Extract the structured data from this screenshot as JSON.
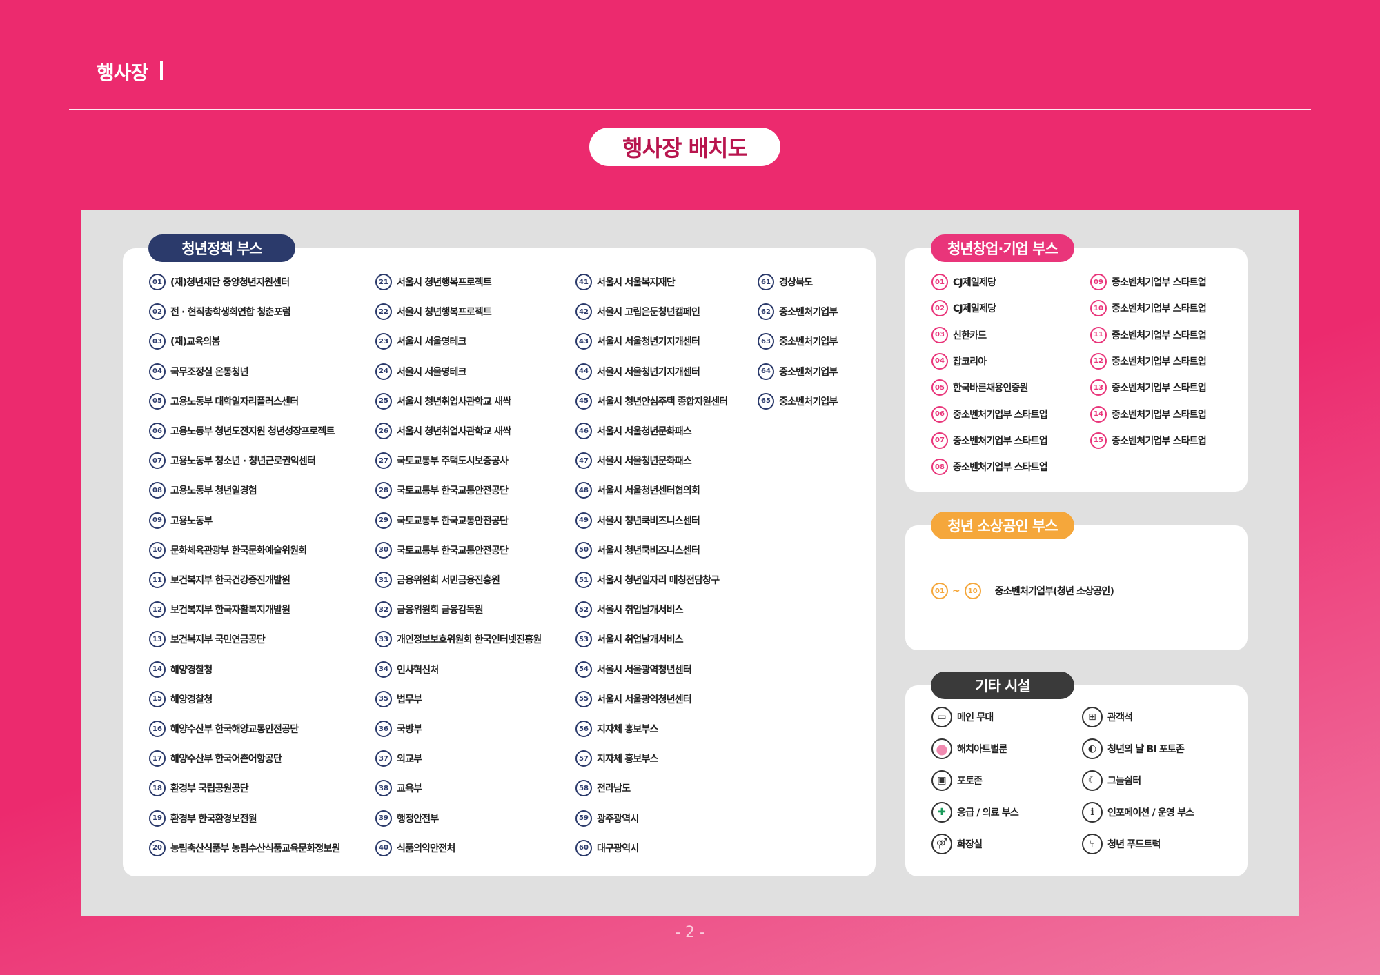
{
  "header": {
    "title": "행사장"
  },
  "main_title": "행사장 배치도",
  "policy": {
    "title": "청년정책 부스",
    "items": [
      {
        "n": "01",
        "t": "(재)청년재단 중앙청년지원센터"
      },
      {
        "n": "02",
        "t": "전 · 현직총학생회연합 청춘포럼"
      },
      {
        "n": "03",
        "t": "(재)교육의봄"
      },
      {
        "n": "04",
        "t": "국무조정실 온통청년"
      },
      {
        "n": "05",
        "t": "고용노동부 대학일자리플러스센터"
      },
      {
        "n": "06",
        "t": "고용노동부 청년도전지원 청년성장프로젝트"
      },
      {
        "n": "07",
        "t": "고용노동부 청소년 · 청년근로권익센터"
      },
      {
        "n": "08",
        "t": "고용노동부 청년일경험"
      },
      {
        "n": "09",
        "t": "고용노동부"
      },
      {
        "n": "10",
        "t": "문화체육관광부 한국문화예술위원회"
      },
      {
        "n": "11",
        "t": "보건복지부 한국건강증진개발원"
      },
      {
        "n": "12",
        "t": "보건복지부 한국자활복지개발원"
      },
      {
        "n": "13",
        "t": "보건복지부 국민연금공단"
      },
      {
        "n": "14",
        "t": "해양경찰청"
      },
      {
        "n": "15",
        "t": "해양경찰청"
      },
      {
        "n": "16",
        "t": "해양수산부 한국해양교통안전공단"
      },
      {
        "n": "17",
        "t": "해양수산부 한국어촌어항공단"
      },
      {
        "n": "18",
        "t": "환경부 국립공원공단"
      },
      {
        "n": "19",
        "t": "환경부 한국환경보전원"
      },
      {
        "n": "20",
        "t": "농림축산식품부 농림수산식품교육문화정보원"
      },
      {
        "n": "21",
        "t": "서울시 청년행복프로젝트"
      },
      {
        "n": "22",
        "t": "서울시 청년행복프로젝트"
      },
      {
        "n": "23",
        "t": "서울시 서울영테크"
      },
      {
        "n": "24",
        "t": "서울시 서울영테크"
      },
      {
        "n": "25",
        "t": "서울시 청년취업사관학교 새싹"
      },
      {
        "n": "26",
        "t": "서울시 청년취업사관학교 새싹"
      },
      {
        "n": "27",
        "t": "국토교통부 주택도시보증공사"
      },
      {
        "n": "28",
        "t": "국토교통부 한국교통안전공단"
      },
      {
        "n": "29",
        "t": "국토교통부 한국교통안전공단"
      },
      {
        "n": "30",
        "t": "국토교통부 한국교통안전공단"
      },
      {
        "n": "31",
        "t": "금융위원회 서민금융진흥원"
      },
      {
        "n": "32",
        "t": "금융위원회 금융감독원"
      },
      {
        "n": "33",
        "t": "개인정보보호위원회 한국인터넷진흥원"
      },
      {
        "n": "34",
        "t": "인사혁신처"
      },
      {
        "n": "35",
        "t": "법무부"
      },
      {
        "n": "36",
        "t": "국방부"
      },
      {
        "n": "37",
        "t": "외교부"
      },
      {
        "n": "38",
        "t": "교육부"
      },
      {
        "n": "39",
        "t": "행정안전부"
      },
      {
        "n": "40",
        "t": "식품의약안전처"
      },
      {
        "n": "41",
        "t": "서울시 서울복지재단"
      },
      {
        "n": "42",
        "t": "서울시 고립은둔청년캠페인"
      },
      {
        "n": "43",
        "t": "서울시 서울청년기지개센터"
      },
      {
        "n": "44",
        "t": "서울시 서울청년기지개센터"
      },
      {
        "n": "45",
        "t": "서울시 청년안심주택 종합지원센터"
      },
      {
        "n": "46",
        "t": "서울시 서울청년문화패스"
      },
      {
        "n": "47",
        "t": "서울시 서울청년문화패스"
      },
      {
        "n": "48",
        "t": "서울시 서울청년센터협의회"
      },
      {
        "n": "49",
        "t": "서울시 청년쿡비즈니스센터"
      },
      {
        "n": "50",
        "t": "서울시 청년쿡비즈니스센터"
      },
      {
        "n": "51",
        "t": "서울시 청년일자리 매칭전담창구"
      },
      {
        "n": "52",
        "t": "서울시 취업날개서비스"
      },
      {
        "n": "53",
        "t": "서울시 취업날개서비스"
      },
      {
        "n": "54",
        "t": "서울시 서울광역청년센터"
      },
      {
        "n": "55",
        "t": "서울시 서울광역청년센터"
      },
      {
        "n": "56",
        "t": "지자체 홍보부스"
      },
      {
        "n": "57",
        "t": "지자체 홍보부스"
      },
      {
        "n": "58",
        "t": "전라남도"
      },
      {
        "n": "59",
        "t": "광주광역시"
      },
      {
        "n": "60",
        "t": "대구광역시"
      },
      {
        "n": "61",
        "t": "경상북도"
      },
      {
        "n": "62",
        "t": "중소벤처기업부"
      },
      {
        "n": "63",
        "t": "중소벤처기업부"
      },
      {
        "n": "64",
        "t": "중소벤처기업부"
      },
      {
        "n": "65",
        "t": "중소벤처기업부"
      }
    ]
  },
  "startup": {
    "title": "청년창업·기업 부스",
    "items": [
      {
        "n": "01",
        "t": "CJ제일제당"
      },
      {
        "n": "02",
        "t": "CJ제일제당"
      },
      {
        "n": "03",
        "t": "신한카드"
      },
      {
        "n": "04",
        "t": "잡코리아"
      },
      {
        "n": "05",
        "t": "한국바른채용인증원"
      },
      {
        "n": "06",
        "t": "중소벤처기업부 스타트업"
      },
      {
        "n": "07",
        "t": "중소벤처기업부 스타트업"
      },
      {
        "n": "08",
        "t": "중소벤처기업부 스타트업"
      },
      {
        "n": "09",
        "t": "중소벤처기업부 스타트업"
      },
      {
        "n": "10",
        "t": "중소벤처기업부 스타트업"
      },
      {
        "n": "11",
        "t": "중소벤처기업부 스타트업"
      },
      {
        "n": "12",
        "t": "중소벤처기업부 스타트업"
      },
      {
        "n": "13",
        "t": "중소벤처기업부 스타트업"
      },
      {
        "n": "14",
        "t": "중소벤처기업부 스타트업"
      },
      {
        "n": "15",
        "t": "중소벤처기업부 스타트업"
      }
    ]
  },
  "small_biz": {
    "title": "청년 소상공인 부스",
    "from": "01",
    "tilde": "~",
    "to": "10",
    "label": "중소벤처기업부(청년 소상공인)"
  },
  "facilities": {
    "title": "기타 시설",
    "items": [
      {
        "icon": "stage-icon",
        "glyph": "▭",
        "t": "메인 무대"
      },
      {
        "icon": "seats-icon",
        "glyph": "⊞",
        "t": "관객석"
      },
      {
        "icon": "mascot-balloon-icon",
        "glyph": "●",
        "t": "해치아트벌룬"
      },
      {
        "icon": "bi-photozone-icon",
        "glyph": "◐",
        "t": "청년의 날 BI 포토존"
      },
      {
        "icon": "camera-icon",
        "glyph": "▣",
        "t": "포토존"
      },
      {
        "icon": "moon-icon",
        "glyph": "☾",
        "t": "그늘쉼터"
      },
      {
        "icon": "medical-cross-icon",
        "glyph": "✚",
        "t": "응급 / 의료 부스"
      },
      {
        "icon": "info-icon",
        "glyph": "i",
        "t": "인포메이션 / 운영 부스"
      },
      {
        "icon": "restroom-icon",
        "glyph": "⚤",
        "t": "화장실"
      },
      {
        "icon": "food-truck-icon",
        "glyph": "⑂",
        "t": "청년 푸드트럭"
      }
    ]
  },
  "page_number": "- 2 -",
  "colors": {
    "background": "#ec2a6e",
    "navy": "#2b3a6b",
    "pink": "#e9357a",
    "orange": "#f5a73b",
    "dark": "#3a3a3a"
  }
}
